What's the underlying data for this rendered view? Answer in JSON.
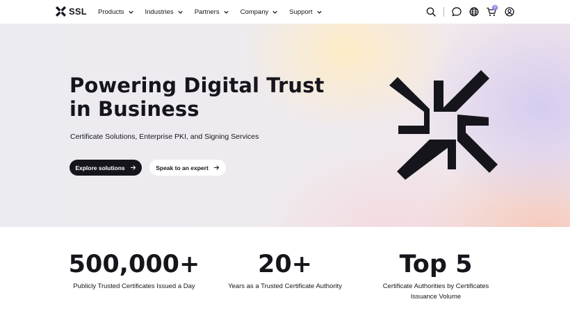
{
  "brand": {
    "logo_text": "SSL"
  },
  "nav": {
    "items": [
      {
        "label": "Products"
      },
      {
        "label": "Industries"
      },
      {
        "label": "Partners"
      },
      {
        "label": "Company"
      },
      {
        "label": "Support"
      }
    ],
    "icons": [
      "search-icon",
      "chat-icon",
      "globe-icon",
      "cart-icon",
      "account-icon"
    ],
    "cart_count": "0"
  },
  "hero": {
    "title": "Powering Digital Trust in Business",
    "subtitle": "Certificate Solutions, Enterprise PKI, and Signing Services",
    "primary_button": "Explore solutions",
    "secondary_button": "Speak to an expert"
  },
  "stats": [
    {
      "value": "500,000+",
      "label": "Publicly Trusted Certificates Issued a Day"
    },
    {
      "value": "20+",
      "label": "Years as a Trusted Certificate Authority"
    },
    {
      "value": "Top 5",
      "label": "Certificate Authorities by Certificates Issuance Volume"
    }
  ],
  "colors": {
    "text": "#16151c",
    "primary_button_bg": "#16151c",
    "badge": "#8f86e6"
  }
}
